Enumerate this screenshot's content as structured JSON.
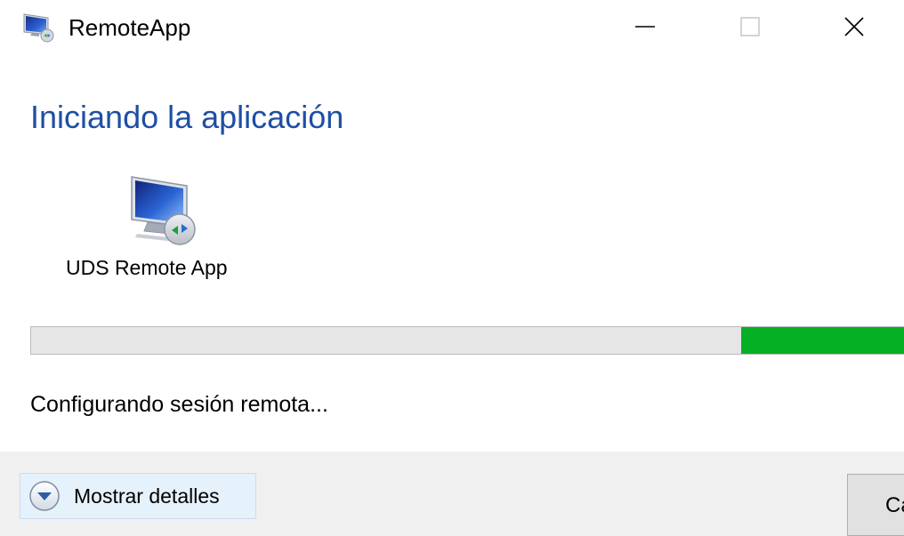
{
  "window": {
    "title": "RemoteApp",
    "icon": "remoteapp-monitor-icon",
    "controls": {
      "minimize_icon": "minimize-icon",
      "maximize_icon": "maximize-icon",
      "close_icon": "close-icon"
    }
  },
  "main": {
    "heading": "Iniciando la aplicación",
    "app": {
      "name": "UDS Remote App",
      "icon": "remote-desktop-monitor-icon"
    },
    "progress": {
      "style": "marquee",
      "chunk_start": 0.8,
      "chunk_end": 1.0,
      "color": "#06b025",
      "track_color": "#e6e6e6"
    },
    "status": "Configurando sesión remota..."
  },
  "footer": {
    "details_label": "Mostrar detalles",
    "details_icon": "chevron-down-circle-icon",
    "cancel_label": "Ca"
  },
  "colors": {
    "heading": "#1e4fa3",
    "footer_bg": "#f0f0f0",
    "details_bg": "#e5f1fb"
  }
}
